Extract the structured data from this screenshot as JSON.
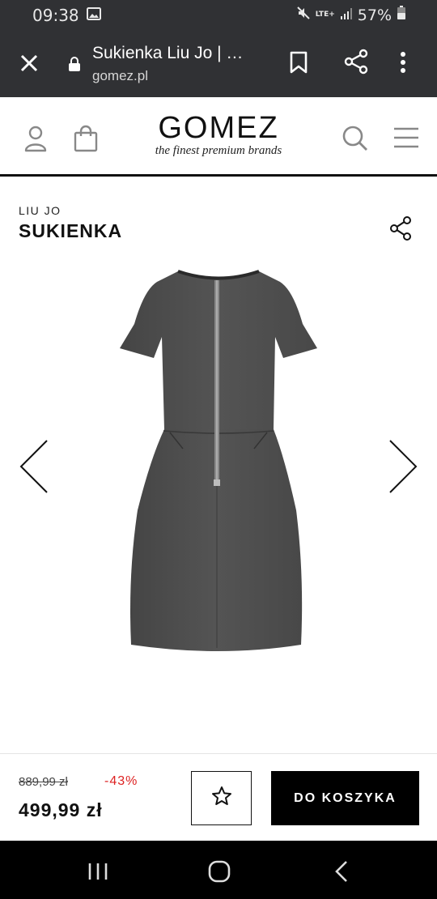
{
  "status_bar": {
    "time": "09:38",
    "network": "LTE+",
    "battery": "57%"
  },
  "browser": {
    "title": "Sukienka Liu Jo | …",
    "url": "gomez.pl"
  },
  "site": {
    "logo_text": "GOMEZ",
    "tagline": "the finest premium brands"
  },
  "product": {
    "brand": "LIU JO",
    "name": "SUKIENKA",
    "old_price": "889,99 zł",
    "discount": "-43%",
    "price": "499,99 zł",
    "cart_label": "DO KOSZYKA"
  },
  "colors": {
    "browser_bar": "#303134",
    "accent_discount": "#dd2222",
    "primary_button": "#000000"
  },
  "icons": [
    "gallery-icon",
    "mute-icon",
    "signal-icon",
    "battery-icon",
    "close-icon",
    "lock-icon",
    "bookmark-icon",
    "share-icon",
    "more-icon",
    "user-icon",
    "bag-icon",
    "search-icon",
    "menu-icon",
    "chevron-left-icon",
    "chevron-right-icon",
    "star-icon",
    "recent-apps-icon",
    "home-icon",
    "back-icon"
  ]
}
